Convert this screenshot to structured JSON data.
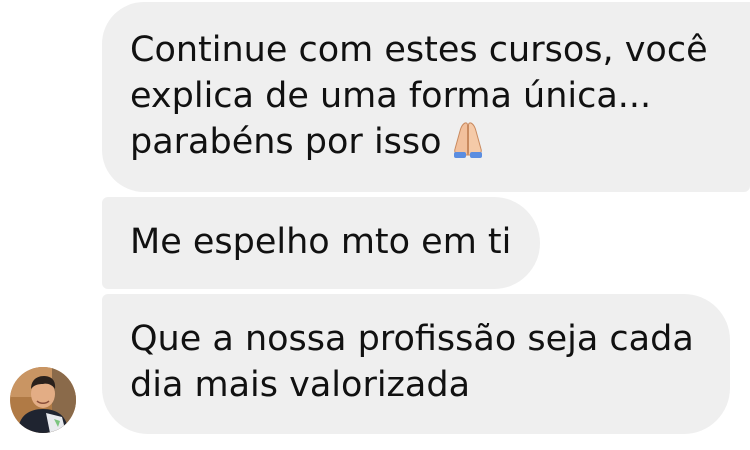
{
  "messages": [
    {
      "text": "Continue com estes cursos, você\nexplica de uma forma única...\nparabéns por isso",
      "emoji": "folded-hands"
    },
    {
      "text": "Me espelho mto em ti"
    },
    {
      "text": "Que a nossa profissão seja cada\ndia mais valorizada"
    }
  ],
  "colors": {
    "bubble": "#efefef",
    "text": "#111111",
    "background": "#ffffff"
  }
}
